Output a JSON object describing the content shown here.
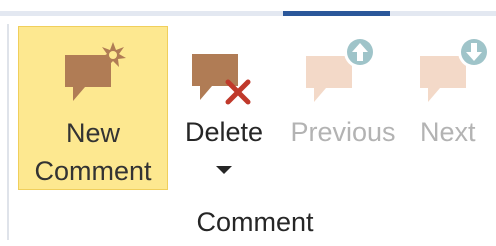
{
  "ribbon": {
    "buttons": {
      "new_comment": {
        "line1": "New",
        "line2": "Comment",
        "icon": "new-comment-icon",
        "state": "highlighted"
      },
      "delete": {
        "label": "Delete",
        "icon": "delete-comment-icon",
        "has_dropdown": true
      },
      "previous": {
        "label": "Previous",
        "icon": "previous-comment-icon",
        "state": "disabled"
      },
      "next": {
        "label": "Next",
        "icon": "next-comment-icon",
        "state": "disabled"
      }
    },
    "group_label": "Comment"
  },
  "colors": {
    "accent_tab": "#2b579a",
    "highlight_bg": "#fde890",
    "comment_icon": "#b07c55",
    "delete_x": "#c0392b",
    "disabled_icon": "#f3d9c8",
    "disabled_text": "#b3b3b3"
  }
}
